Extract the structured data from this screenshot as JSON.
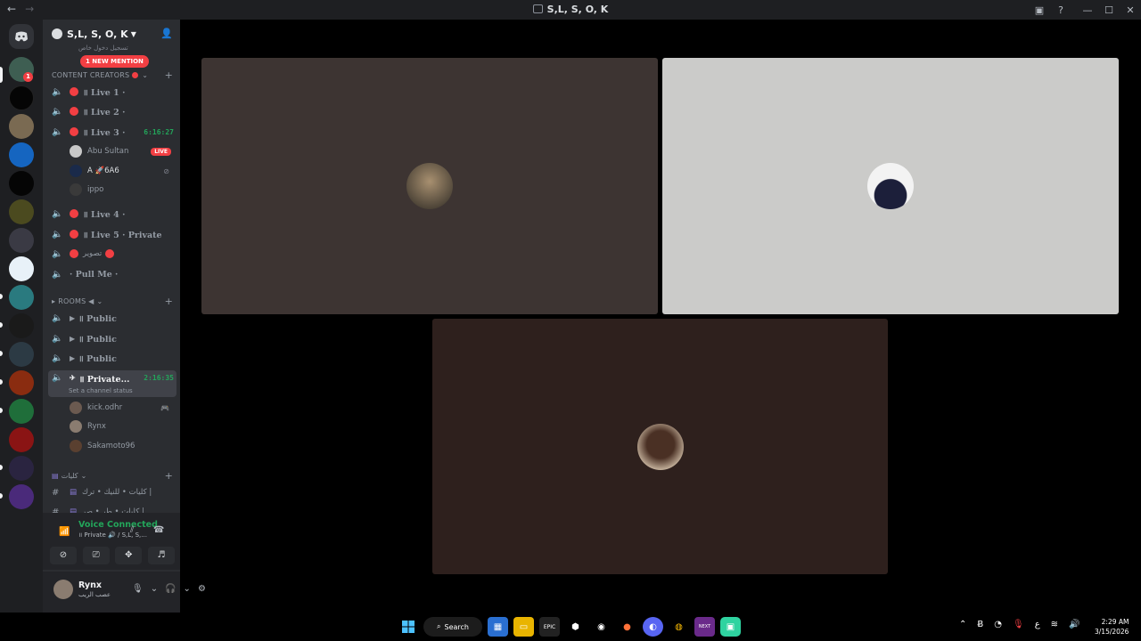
{
  "titlebar": {
    "title": "S,L, S, O, K",
    "back": "←",
    "forward": "→"
  },
  "guild": {
    "name": "S,L, S, O, K",
    "cut_text": "تسجيل دخول خاص",
    "mention": "1 NEW MENTION"
  },
  "categories": {
    "content_creators": "CONTENT CREATORS",
    "rooms": "ROOMS ◀",
    "kalimat": "كليات"
  },
  "channels": {
    "live1": "॥ Live 1 ·",
    "live2": "॥ Live 2 ·",
    "live3": "॥ Live 3 ·",
    "live3_timer": "6:16:27",
    "live4": "॥ Live 4 ·",
    "live5": "॥ Live 5 · Private",
    "tasweer": "تصوير",
    "pullme": "· Pull Me ·",
    "public1": "॥ Public",
    "public2": "॥ Public",
    "public3": "॥ Public",
    "private": "॥ Private...",
    "private_timer": "2:16:35",
    "private_status": "Set a channel status",
    "text1": "كليات • للنيك • ترك |",
    "text2": "كليات • طر • صر |"
  },
  "live3_users": [
    {
      "name": "Abu Sultan",
      "badge": "LIVE"
    },
    {
      "name": "A 🚀6A6"
    },
    {
      "name": "ippo"
    }
  ],
  "private_users": [
    {
      "name": "kick.odhr"
    },
    {
      "name": "Rynx"
    },
    {
      "name": "Sakamoto96"
    }
  ],
  "voice": {
    "status": "Voice Connected",
    "sub": "॥ Private 🔊 / S,L, S,..."
  },
  "me": {
    "name": "Rynx",
    "status": "عصب الريب"
  },
  "taskbar": {
    "search": "Search",
    "time": "2:29 AM",
    "date": "3/15/2026",
    "lang": "ع"
  },
  "colors": {
    "tile1": "#3d3432",
    "tile2": "#cbcbc9",
    "tile3": "#2e201d",
    "accent_green": "#23a55a",
    "mention_red": "#f23f43"
  }
}
